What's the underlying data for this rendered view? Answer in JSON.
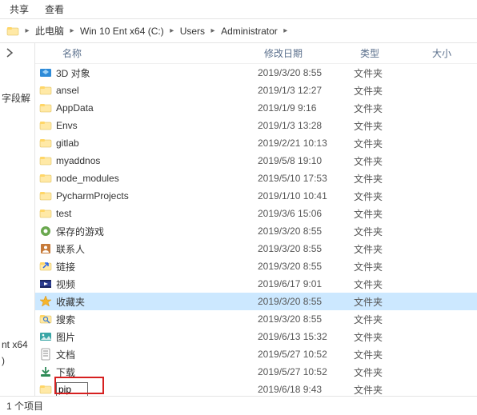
{
  "tabs": {
    "share": "共享",
    "view": "查看"
  },
  "breadcrumbs": {
    "items": [
      {
        "label": "此电脑"
      },
      {
        "label": "Win 10 Ent x64 (C:)"
      },
      {
        "label": "Users"
      },
      {
        "label": "Administrator"
      }
    ]
  },
  "nav_fragments": {
    "line1": "字段解",
    "line2": "nt x64",
    "line3": ")"
  },
  "columns": {
    "name": "名称",
    "date": "修改日期",
    "type": "类型",
    "size": "大小"
  },
  "rows": [
    {
      "icon": "3d",
      "name": "3D 对象",
      "date": "2019/3/20 8:55",
      "type": "文件夹"
    },
    {
      "icon": "folder",
      "name": "ansel",
      "date": "2019/1/3 12:27",
      "type": "文件夹"
    },
    {
      "icon": "folder",
      "name": "AppData",
      "date": "2019/1/9 9:16",
      "type": "文件夹"
    },
    {
      "icon": "folder",
      "name": "Envs",
      "date": "2019/1/3 13:28",
      "type": "文件夹"
    },
    {
      "icon": "folder",
      "name": "gitlab",
      "date": "2019/2/21 10:13",
      "type": "文件夹"
    },
    {
      "icon": "folder",
      "name": "myaddnos",
      "date": "2019/5/8 19:10",
      "type": "文件夹"
    },
    {
      "icon": "folder",
      "name": "node_modules",
      "date": "2019/5/10 17:53",
      "type": "文件夹"
    },
    {
      "icon": "folder",
      "name": "PycharmProjects",
      "date": "2019/1/10 10:41",
      "type": "文件夹"
    },
    {
      "icon": "folder",
      "name": "test",
      "date": "2019/3/6 15:06",
      "type": "文件夹"
    },
    {
      "icon": "games",
      "name": "保存的游戏",
      "date": "2019/3/20 8:55",
      "type": "文件夹"
    },
    {
      "icon": "contacts",
      "name": "联系人",
      "date": "2019/3/20 8:55",
      "type": "文件夹"
    },
    {
      "icon": "links",
      "name": "链接",
      "date": "2019/3/20 8:55",
      "type": "文件夹"
    },
    {
      "icon": "videos",
      "name": "视频",
      "date": "2019/6/17 9:01",
      "type": "文件夹"
    },
    {
      "icon": "favorites",
      "name": "收藏夹",
      "date": "2019/3/20 8:55",
      "type": "文件夹",
      "selected": true
    },
    {
      "icon": "searches",
      "name": "搜索",
      "date": "2019/3/20 8:55",
      "type": "文件夹"
    },
    {
      "icon": "pictures",
      "name": "图片",
      "date": "2019/6/13 15:32",
      "type": "文件夹"
    },
    {
      "icon": "documents",
      "name": "文档",
      "date": "2019/5/27 10:52",
      "type": "文件夹"
    },
    {
      "icon": "downloads",
      "name": "下载",
      "date": "2019/5/27 10:52",
      "type": "文件夹"
    },
    {
      "icon": "folder",
      "name": "pip",
      "date": "2019/6/18 9:43",
      "type": "文件夹",
      "editing": true
    }
  ],
  "status": "1 个项目",
  "icon_colors": {
    "folder_fill": "#ffe9a6",
    "folder_tab": "#ffd667"
  }
}
